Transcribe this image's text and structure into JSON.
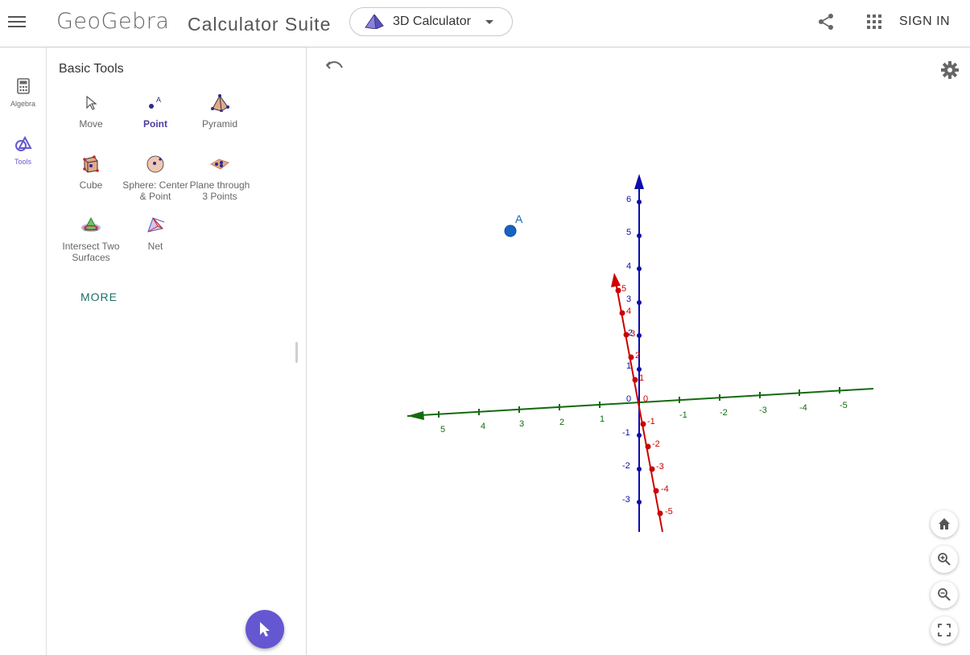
{
  "header": {
    "brand": "GeoGebra",
    "suite_title": "Calculator Suite",
    "app_selector": {
      "label": "3D Calculator"
    },
    "sign_in_label": "SIGN IN"
  },
  "rail": {
    "items": [
      {
        "label": "Algebra",
        "icon": "calculator-icon"
      },
      {
        "label": "Tools",
        "icon": "tools-icon",
        "active": true
      }
    ]
  },
  "tools_panel": {
    "title": "Basic Tools",
    "tools": [
      {
        "label": "Move",
        "icon": "move-icon"
      },
      {
        "label": "Point",
        "icon": "point-icon",
        "active": true
      },
      {
        "label": "Pyramid",
        "icon": "pyramid-icon"
      },
      {
        "label": "Cube",
        "icon": "cube-icon"
      },
      {
        "label": "Sphere: Center & Point",
        "icon": "sphere-icon"
      },
      {
        "label": "Plane through 3 Points",
        "icon": "plane-icon"
      },
      {
        "label": "Intersect Two Surfaces",
        "icon": "intersect-surfaces-icon"
      },
      {
        "label": "Net",
        "icon": "net-icon"
      }
    ],
    "more_label": "MORE"
  },
  "graphics": {
    "point": {
      "name": "A",
      "color": "#1565c0"
    },
    "axes": {
      "z": {
        "color": "#0d0daa",
        "labels": [
          "6",
          "5",
          "4",
          "3",
          "2",
          "1",
          "0",
          "-1",
          "-2",
          "-3"
        ]
      },
      "x": {
        "color": "#cc0000",
        "labels": [
          "5",
          "4",
          "3",
          "2",
          "1",
          "0",
          "-1",
          "-2",
          "-3",
          "-4",
          "-5"
        ]
      },
      "y": {
        "color": "#136b0e",
        "labels": [
          "5",
          "4",
          "3",
          "2",
          "1",
          "-1",
          "-2",
          "-3",
          "-4",
          "-5"
        ]
      }
    }
  },
  "colors": {
    "accent": "#6557d2",
    "more": "#1b6f6a"
  }
}
